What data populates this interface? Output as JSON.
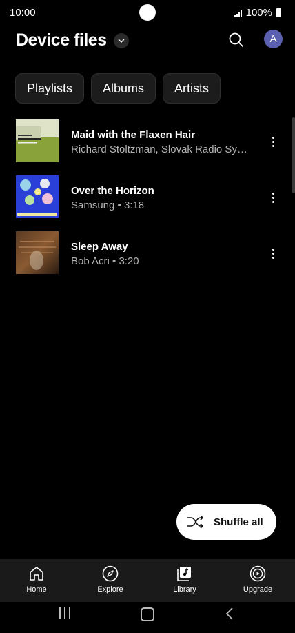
{
  "status_bar": {
    "time": "10:00",
    "battery": "100%"
  },
  "header": {
    "title": "Device files",
    "avatar_letter": "A"
  },
  "chips": [
    "Playlists",
    "Albums",
    "Artists"
  ],
  "tracks": [
    {
      "title": "Maid with the Flaxen Hair",
      "subtitle": "Richard Stoltzman, Slovak Radio Symphony Orchestra",
      "art": "album-art-stoltzman"
    },
    {
      "title": "Over the Horizon",
      "subtitle": "Samsung • 3:18",
      "art": "album-art-over-the-horizon"
    },
    {
      "title": "Sleep Away",
      "subtitle": "Bob Acri • 3:20",
      "art": "album-art-sleep-away"
    }
  ],
  "shuffle": {
    "label": "Shuffle all"
  },
  "bottom_nav": [
    {
      "label": "Home",
      "icon": "home-icon"
    },
    {
      "label": "Explore",
      "icon": "compass-icon"
    },
    {
      "label": "Library",
      "icon": "library-icon"
    },
    {
      "label": "Upgrade",
      "icon": "play-circle-icon"
    }
  ],
  "colors": {
    "background": "#000000",
    "chip_bg": "#1c1c1c",
    "avatar": "#5b5fb0",
    "nav_bg": "#1a1a1a",
    "subtitle": "#b3b3b3"
  }
}
